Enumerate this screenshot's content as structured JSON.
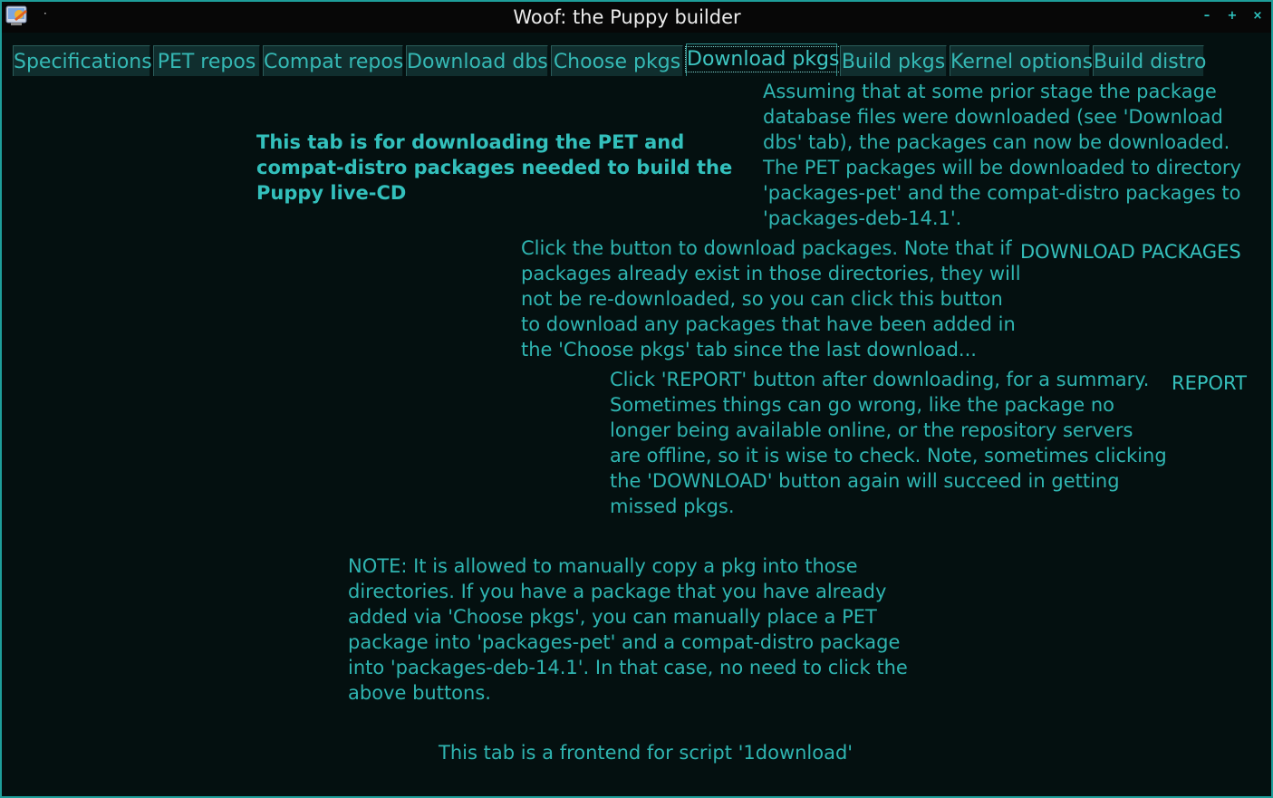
{
  "window": {
    "title": "Woof: the Puppy builder",
    "title_dot": "·",
    "minimize_glyph": "–",
    "maximize_glyph": "+",
    "close_glyph": "×"
  },
  "tabs": [
    {
      "label": "Specifications",
      "active": false
    },
    {
      "label": "PET repos",
      "active": false
    },
    {
      "label": "Compat repos",
      "active": false
    },
    {
      "label": "Download dbs",
      "active": false
    },
    {
      "label": "Choose pkgs",
      "active": false
    },
    {
      "label": "Download pkgs",
      "active": true
    },
    {
      "label": "Build pkgs",
      "active": false
    },
    {
      "label": "Kernel options",
      "active": false
    },
    {
      "label": "Build distro",
      "active": false
    }
  ],
  "content": {
    "heading": "This tab is for downloading the PET and compat-distro packages needed to build the Puppy live-CD",
    "intro": "Assuming that at some prior stage the package database files were downloaded (see 'Download dbs' tab), the packages can now be downloaded. The PET packages will be downloaded to directory 'packages-pet' and the compat-distro packages to 'packages-deb-14.1'.",
    "download_text": "Click the button to download packages. Note that if packages already exist in those directories, they will not be re-downloaded, so you can click this button to download any packages that have been added in the 'Choose pkgs' tab since the last download...",
    "download_button": "DOWNLOAD PACKAGES",
    "report_text": "Click 'REPORT' button after downloading, for a summary. Sometimes things can go wrong, like the package no longer being available online, or the repository servers are offline, so it is wise to check. Note, sometimes clicking the 'DOWNLOAD' button again will succeed in getting missed pkgs.",
    "report_button": "REPORT",
    "note": "NOTE: It is allowed to manually copy a pkg into those directories. If you have a package that you have already added via 'Choose pkgs', you can manually place a PET package into 'packages-pet' and a compat-distro package into 'packages-deb-14.1'. In that case, no need to click the above buttons.",
    "footer": "This tab is a frontend for script '1download'"
  },
  "colors": {
    "text": "#2fb5b1",
    "background": "#041010",
    "border": "#1e9e9a"
  }
}
